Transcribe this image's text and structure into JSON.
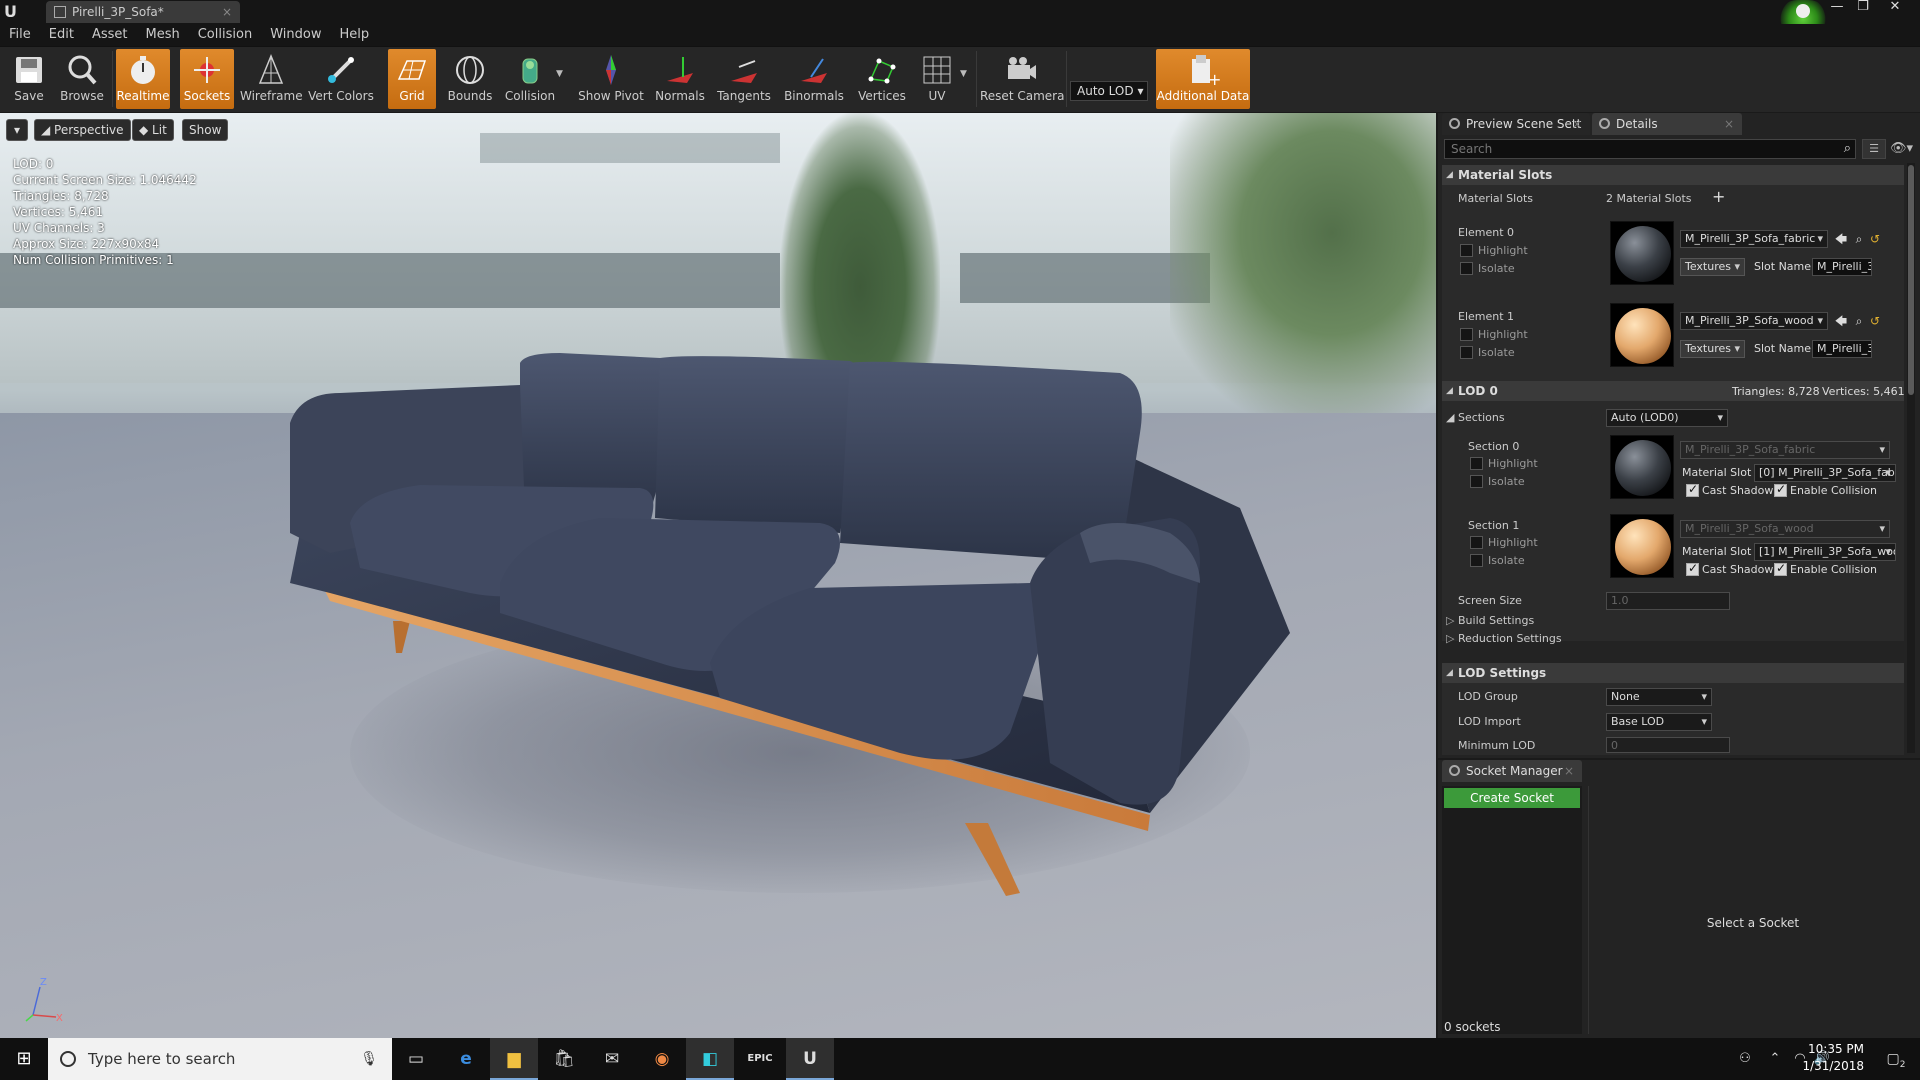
{
  "window": {
    "tab_title": "Pirelli_3P_Sofa*",
    "minimize": "—",
    "restore": "❐",
    "close": "✕"
  },
  "menu": [
    "File",
    "Edit",
    "Asset",
    "Mesh",
    "Collision",
    "Window",
    "Help"
  ],
  "toolbar": {
    "buttons": [
      {
        "label": "Save",
        "icon": "save-icon",
        "active": false
      },
      {
        "label": "Browse",
        "icon": "browse-icon",
        "active": false
      },
      {
        "label": "Realtime",
        "icon": "realtime-icon",
        "active": true
      },
      {
        "label": "Sockets",
        "icon": "sockets-icon",
        "active": true
      },
      {
        "label": "Wireframe",
        "icon": "wireframe-icon",
        "active": false
      },
      {
        "label": "Vert Colors",
        "icon": "vert-colors-icon",
        "active": false
      },
      {
        "label": "Grid",
        "icon": "grid-icon",
        "active": true
      },
      {
        "label": "Bounds",
        "icon": "bounds-icon",
        "active": false
      },
      {
        "label": "Collision",
        "icon": "collision-icon",
        "active": false
      },
      {
        "label": "Show Pivot",
        "icon": "show-pivot-icon",
        "active": false
      },
      {
        "label": "Normals",
        "icon": "normals-icon",
        "active": false
      },
      {
        "label": "Tangents",
        "icon": "tangents-icon",
        "active": false
      },
      {
        "label": "Binormals",
        "icon": "binormals-icon",
        "active": false
      },
      {
        "label": "Vertices",
        "icon": "vertices-icon",
        "active": false
      },
      {
        "label": "UV",
        "icon": "uv-icon",
        "active": false
      },
      {
        "label": "Reset Camera",
        "icon": "reset-camera-icon",
        "active": false
      },
      {
        "label": "Additional Data",
        "icon": "additional-data-icon",
        "active": true
      }
    ],
    "lod_select": "Auto LOD"
  },
  "viewport": {
    "options_caret": "▾",
    "perspective": "Perspective",
    "lit": "Lit",
    "show": "Show",
    "stats": [
      "LOD:  0",
      "Current Screen Size:  1.046442",
      "Triangles:  8,728",
      "Vertices:  5,461",
      "UV Channels:  3",
      "Approx Size:  227x90x84",
      "Num Collision Primitives:  1"
    ],
    "axis_z": "Z",
    "axis_x": "X"
  },
  "panel": {
    "tabs": [
      "Preview Scene Sett",
      "Details"
    ],
    "search_placeholder": "Search",
    "material_slots": {
      "header": "Material Slots",
      "label": "Material Slots",
      "count": "2 Material Slots",
      "add": "+",
      "elements": [
        {
          "label": "Element 0",
          "highlight": "Highlight",
          "isolate": "Isolate",
          "material": "M_Pirelli_3P_Sofa_fabric",
          "textures": "Textures",
          "slot_name_label": "Slot Name",
          "slot_name": "M_Pirelli_3"
        },
        {
          "label": "Element 1",
          "highlight": "Highlight",
          "isolate": "Isolate",
          "material": "M_Pirelli_3P_Sofa_wood",
          "textures": "Textures",
          "slot_name_label": "Slot Name",
          "slot_name": "M_Pirelli_3"
        }
      ]
    },
    "lod0": {
      "header": "LOD 0",
      "triangles": "Triangles: 8,728",
      "vertices": "Vertices: 5,461",
      "sections_label": "Sections",
      "sections_value": "Auto (LOD0)",
      "sections": [
        {
          "label": "Section 0",
          "highlight": "Highlight",
          "isolate": "Isolate",
          "material": "M_Pirelli_3P_Sofa_fabric",
          "slot_label": "Material Slot",
          "slot": "[0] M_Pirelli_3P_Sofa_fab",
          "cast_shadow": "Cast Shadow",
          "enable_collision": "Enable Collision"
        },
        {
          "label": "Section 1",
          "highlight": "Highlight",
          "isolate": "Isolate",
          "material": "M_Pirelli_3P_Sofa_wood",
          "slot_label": "Material Slot",
          "slot": "[1] M_Pirelli_3P_Sofa_woo",
          "cast_shadow": "Cast Shadow",
          "enable_collision": "Enable Collision"
        }
      ],
      "screen_size_label": "Screen Size",
      "screen_size": "1.0",
      "build_settings": "Build Settings",
      "reduction_settings": "Reduction Settings"
    },
    "lod_settings": {
      "header": "LOD Settings",
      "group_label": "LOD Group",
      "group": "None",
      "import_label": "LOD Import",
      "import": "Base LOD",
      "min_lod_label": "Minimum LOD",
      "min_lod": "0"
    }
  },
  "socket_manager": {
    "tab": "Socket Manager",
    "create": "Create Socket",
    "count": "0 sockets",
    "empty": "Select a Socket"
  },
  "taskbar": {
    "search_placeholder": "Type here to search",
    "time": "10:35 PM",
    "date": "1/31/2018",
    "notifications": "2"
  },
  "colors": {
    "accent_orange": "#e08a2c",
    "create_green": "#3c9a3a"
  }
}
